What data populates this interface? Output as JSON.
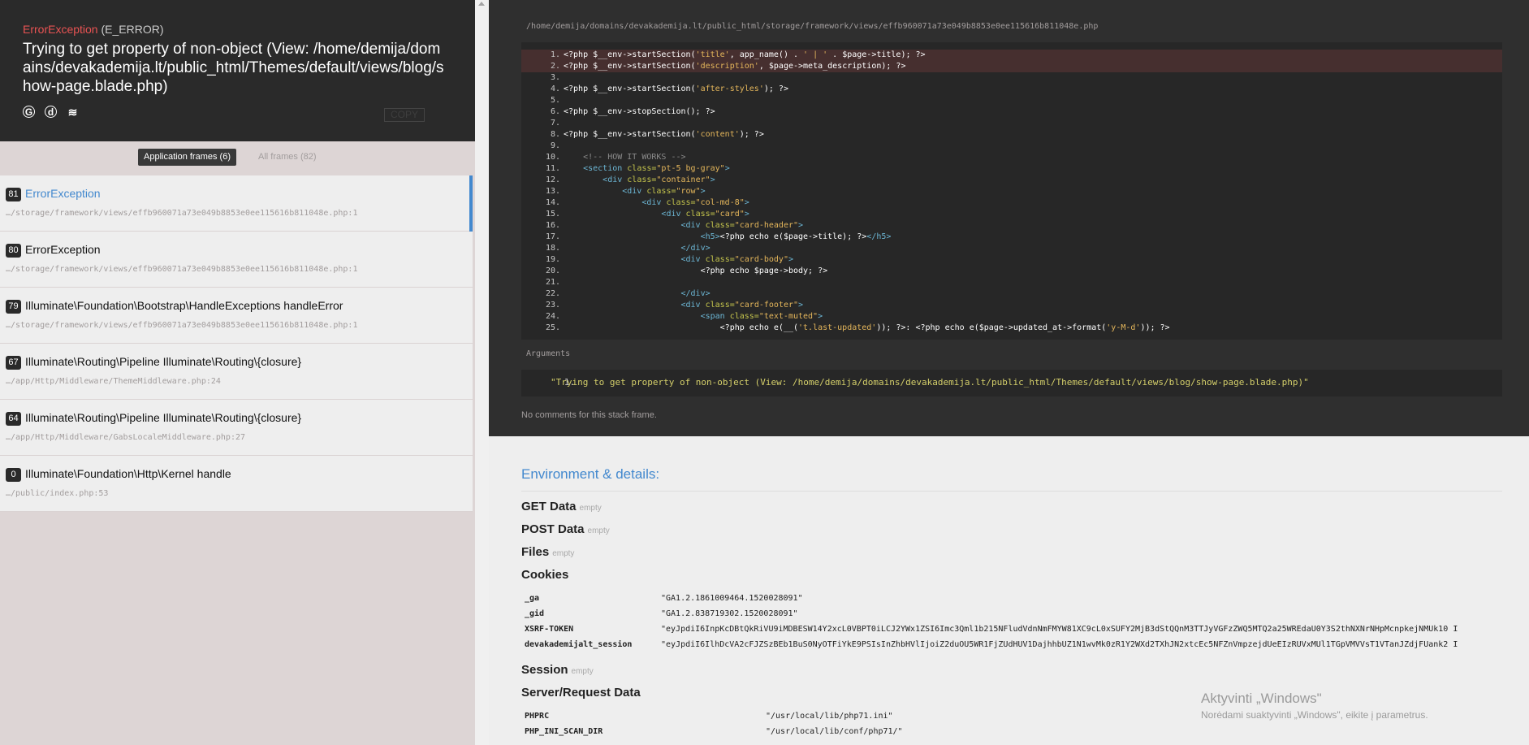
{
  "header": {
    "exception_class": "ErrorException",
    "exception_code": "(E_ERROR)",
    "message": "Trying to get property of non-object (View: /home/demija/domains/devakademija.lt/public_html/Themes/default/views/blog/show-page.blade.php)",
    "icons": [
      "google-search-icon",
      "duckduckgo-icon",
      "stackoverflow-icon"
    ],
    "copy_label": "COPY"
  },
  "frame_tabs": {
    "application": "Application frames (6)",
    "all": "All frames (82)"
  },
  "frames": [
    {
      "index": "81",
      "class": "ErrorException",
      "file": "…/storage/framework/views/effb960071a73e049b8853e0ee115616b811048e.php:1",
      "active": true
    },
    {
      "index": "80",
      "class": "ErrorException",
      "file": "…/storage/framework/views/effb960071a73e049b8853e0ee115616b811048e.php:1"
    },
    {
      "index": "79",
      "class": "Illuminate\\Foundation\\Bootstrap\\HandleExceptions handleError",
      "file": "…/storage/framework/views/effb960071a73e049b8853e0ee115616b811048e.php:1"
    },
    {
      "index": "67",
      "class": "Illuminate\\Routing\\Pipeline Illuminate\\Routing\\{closure}",
      "file": "…/app/Http/Middleware/ThemeMiddleware.php:24"
    },
    {
      "index": "64",
      "class": "Illuminate\\Routing\\Pipeline Illuminate\\Routing\\{closure}",
      "file": "…/app/Http/Middleware/GabsLocaleMiddleware.php:27"
    },
    {
      "index": "0",
      "class": "Illuminate\\Foundation\\Http\\Kernel handle",
      "file": "…/public/index.php:53"
    }
  ],
  "frame_detail": {
    "file_path": "/home/demija/domains/devakademija.lt/public_html/storage/framework/views/effb960071a73e049b8853e0ee115616b811048e.php",
    "code_lines": [
      {
        "n": "1.",
        "hl": true,
        "tokens": [
          [
            "p",
            "<?php $__env->startSection("
          ],
          [
            "s",
            "'title'"
          ],
          [
            "p",
            ", app_name() . "
          ],
          [
            "s",
            "' | '"
          ],
          [
            "p",
            " . $page->title); ?>"
          ]
        ]
      },
      {
        "n": "2.",
        "hl": true,
        "tokens": [
          [
            "p",
            "<?php $__env->startSection("
          ],
          [
            "s",
            "'description'"
          ],
          [
            "p",
            ", $page->meta_description); ?>"
          ]
        ]
      },
      {
        "n": "3.",
        "tokens": []
      },
      {
        "n": "4.",
        "tokens": [
          [
            "p",
            "<?php $__env->startSection("
          ],
          [
            "s",
            "'after-styles'"
          ],
          [
            "p",
            "); ?>"
          ]
        ]
      },
      {
        "n": "5.",
        "tokens": []
      },
      {
        "n": "6.",
        "tokens": [
          [
            "p",
            "<?php $__env->stopSection(); ?>"
          ]
        ]
      },
      {
        "n": "7.",
        "tokens": []
      },
      {
        "n": "8.",
        "tokens": [
          [
            "p",
            "<?php $__env->startSection("
          ],
          [
            "s",
            "'content'"
          ],
          [
            "p",
            "); ?>"
          ]
        ]
      },
      {
        "n": "9.",
        "tokens": []
      },
      {
        "n": "10.",
        "tokens": [
          [
            "p",
            "    "
          ],
          [
            "c",
            "<!-- HOW IT WORKS -->"
          ]
        ]
      },
      {
        "n": "11.",
        "tokens": [
          [
            "p",
            "    "
          ],
          [
            "t",
            "<section "
          ],
          [
            "a",
            "class="
          ],
          [
            "s",
            "\"pt-5 bg-gray\""
          ],
          [
            "t",
            ">"
          ]
        ]
      },
      {
        "n": "12.",
        "tokens": [
          [
            "p",
            "        "
          ],
          [
            "t",
            "<div "
          ],
          [
            "a",
            "class="
          ],
          [
            "s",
            "\"container\""
          ],
          [
            "t",
            ">"
          ]
        ]
      },
      {
        "n": "13.",
        "tokens": [
          [
            "p",
            "            "
          ],
          [
            "t",
            "<div "
          ],
          [
            "a",
            "class="
          ],
          [
            "s",
            "\"row\""
          ],
          [
            "t",
            ">"
          ]
        ]
      },
      {
        "n": "14.",
        "tokens": [
          [
            "p",
            "                "
          ],
          [
            "t",
            "<div "
          ],
          [
            "a",
            "class="
          ],
          [
            "s",
            "\"col-md-8\""
          ],
          [
            "t",
            ">"
          ]
        ]
      },
      {
        "n": "15.",
        "tokens": [
          [
            "p",
            "                    "
          ],
          [
            "t",
            "<div "
          ],
          [
            "a",
            "class="
          ],
          [
            "s",
            "\"card\""
          ],
          [
            "t",
            ">"
          ]
        ]
      },
      {
        "n": "16.",
        "tokens": [
          [
            "p",
            "                        "
          ],
          [
            "t",
            "<div "
          ],
          [
            "a",
            "class="
          ],
          [
            "s",
            "\"card-header\""
          ],
          [
            "t",
            ">"
          ]
        ]
      },
      {
        "n": "17.",
        "tokens": [
          [
            "p",
            "                            "
          ],
          [
            "t",
            "<h5>"
          ],
          [
            "p",
            "<?php echo e($page->title); ?>"
          ],
          [
            "t",
            "</h5>"
          ]
        ]
      },
      {
        "n": "18.",
        "tokens": [
          [
            "p",
            "                        "
          ],
          [
            "t",
            "</div>"
          ]
        ]
      },
      {
        "n": "19.",
        "tokens": [
          [
            "p",
            "                        "
          ],
          [
            "t",
            "<div "
          ],
          [
            "a",
            "class="
          ],
          [
            "s",
            "\"card-body\""
          ],
          [
            "t",
            ">"
          ]
        ]
      },
      {
        "n": "20.",
        "tokens": [
          [
            "p",
            "                            <?php echo $page->body; ?>"
          ]
        ]
      },
      {
        "n": "21.",
        "tokens": []
      },
      {
        "n": "22.",
        "tokens": [
          [
            "p",
            "                        "
          ],
          [
            "t",
            "</div>"
          ]
        ]
      },
      {
        "n": "23.",
        "tokens": [
          [
            "p",
            "                        "
          ],
          [
            "t",
            "<div "
          ],
          [
            "a",
            "class="
          ],
          [
            "s",
            "\"card-footer\""
          ],
          [
            "t",
            ">"
          ]
        ]
      },
      {
        "n": "24.",
        "tokens": [
          [
            "p",
            "                            "
          ],
          [
            "t",
            "<span "
          ],
          [
            "a",
            "class="
          ],
          [
            "s",
            "\"text-muted\""
          ],
          [
            "t",
            ">"
          ]
        ]
      },
      {
        "n": "25.",
        "tokens": [
          [
            "p",
            "                                <?php echo e(__("
          ],
          [
            "s",
            "'t.last-updated'"
          ],
          [
            "p",
            ")); ?>: <?php echo e($page->updated_at->format("
          ],
          [
            "s",
            "'y-M-d'"
          ],
          [
            "p",
            ")); ?>"
          ]
        ]
      }
    ],
    "arguments_label": "Arguments",
    "arguments": [
      {
        "n": "1.",
        "value": "\"Trying to get property of non-object (View: /home/demija/domains/devakademija.lt/public_html/Themes/default/views/blog/show-page.blade.php)\""
      }
    ],
    "comments": "No comments for this stack frame."
  },
  "details": {
    "title": "Environment & details:",
    "empty_label": "empty",
    "get": "GET Data",
    "post": "POST Data",
    "files": "Files",
    "cookies_title": "Cookies",
    "cookies": [
      {
        "key": "_ga",
        "value": "\"GA1.2.1861009464.1520028091\""
      },
      {
        "key": "_gid",
        "value": "\"GA1.2.838719302.1520028091\""
      },
      {
        "key": "XSRF-TOKEN",
        "value": "\"eyJpdiI6InpKcDBtQkRiVU9iMDBESW14Y2xcL0VBPT0iLCJ2YWx1ZSI6Imc3Qml1b215NFludVdnNmFMYW81XC9cL0xSUFY2MjB3dStQQnM3TTJyVGFzZWQ5MTQ2a25WREdaU0Y3S2thNXNrNHpMcnpkejNMUk10 I"
      },
      {
        "key": "devakademijalt_session",
        "value": "\"eyJpdiI6IlhDcVA2cFJZSzBEb1BuS0NyOTFiYkE9PSIsInZhbHVlIjoiZ2duOU5WR1FjZUdHUV1DajhhbUZ1N1wvMk0zR1Y2WXd2TXhJN2xtcEc5NFZnVmpzejdUeEIzRUVxMUl1TGpVMVVsT1VTanJZdjFUank2 I"
      }
    ],
    "session": "Session",
    "server_title": "Server/Request Data",
    "server": [
      {
        "key": "PHPRC",
        "value": "\"/usr/local/lib/php71.ini\""
      },
      {
        "key": "PHP_INI_SCAN_DIR",
        "value": "\"/usr/local/lib/conf/php71/\""
      }
    ]
  },
  "windows_activation": {
    "title": "Aktyvinti „Windows\"",
    "subtitle": "Norėdami suaktyvinti „Windows\", eikite į parametrus."
  }
}
